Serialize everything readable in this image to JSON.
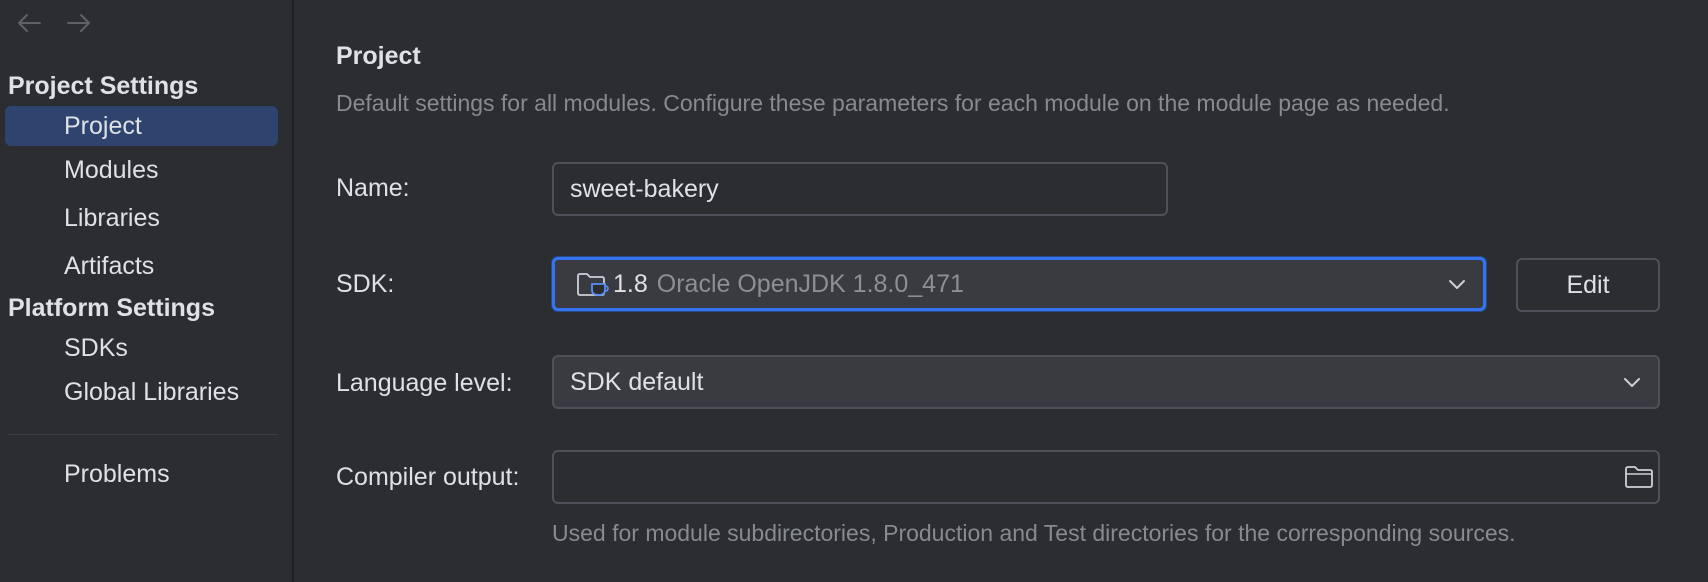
{
  "sidebar": {
    "project_settings_title": "Project Settings",
    "platform_settings_title": "Platform Settings",
    "project_items": [
      {
        "label": "Project",
        "selected": true
      },
      {
        "label": "Modules",
        "selected": false
      },
      {
        "label": "Libraries",
        "selected": false
      },
      {
        "label": "Artifacts",
        "selected": false
      }
    ],
    "platform_items": [
      {
        "label": "SDKs"
      },
      {
        "label": "Global Libraries"
      }
    ],
    "problems_label": "Problems"
  },
  "main": {
    "title": "Project",
    "description": "Default settings for all modules. Configure these parameters for each module on the module page as needed.",
    "name": {
      "label": "Name:",
      "value": "sweet-bakery"
    },
    "sdk": {
      "label": "SDK:",
      "version": "1.8",
      "detail": "Oracle OpenJDK 1.8.0_471",
      "edit_label": "Edit"
    },
    "language_level": {
      "label": "Language level:",
      "value": "SDK default"
    },
    "compiler_output": {
      "label": "Compiler output:",
      "value": "",
      "hint": "Used for module subdirectories, Production and Test directories for the corresponding sources."
    }
  },
  "colors": {
    "background": "#2b2d30",
    "selection": "#2e436e",
    "focus_border": "#3574f0",
    "muted_text": "#868a91"
  },
  "icons": [
    "back-arrow-icon",
    "forward-arrow-icon",
    "sdk-folder-icon",
    "chevron-down-icon",
    "folder-icon"
  ]
}
